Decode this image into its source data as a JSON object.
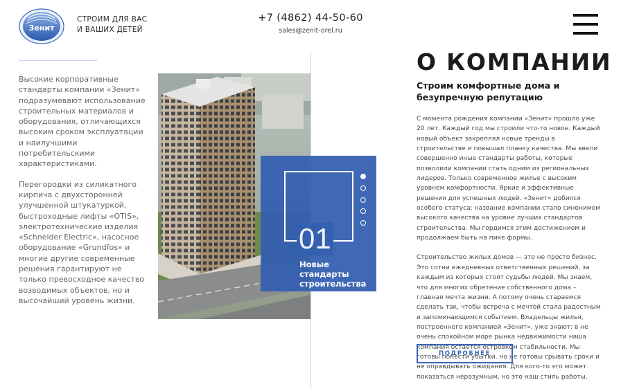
{
  "header": {
    "logo_text": "Зенит",
    "tagline_line1": "СТРОИМ ДЛЯ ВАС",
    "tagline_line2": "И ВАШИХ ДЕТЕЙ",
    "phone": "+7 (4862) 44-50-60",
    "email": "sales@zenit-orel.ru",
    "menu_icon": "hamburger-icon"
  },
  "left_column": {
    "paragraph1": "Высокие корпоративные стандарты компании «Зенит» подразумевают использование строительных материалов и оборудования, отличающихся высоким сроком эксплуатации и наилучшими потребительскими характеристиками.",
    "paragraph2": "Перегородки из силикатного кирпича с двухсторонней улучшенной штукатуркой, быстроходные лифты «OTIS», электротехнические изделия «Schneider Electric», насосное оборудование «Grundfos» и многие другие современные решения гарантируют не только превосходное качество возводимых объектов, но и высочайший уровень жизни."
  },
  "slider": {
    "number": "01",
    "title_line1": "Новые",
    "title_line2": "стандарты",
    "title_line3": "строительства",
    "dot_count": 5,
    "active_dot": 1
  },
  "about": {
    "heading": "О КОМПАНИИ",
    "subtitle": "Строим комфортные дома и безупречную репутацию",
    "paragraph1": "С момента рождения компании «Зенит» прошло уже 20 лет. Каждый год мы строили что-то новое. Каждый новый объект закреплял новые тренды в строительстве и повышал планку качества. Мы ввели совершенно иные стандарты работы, которые позволили компании стать одним из региональных лидеров. Только современное жилье с высоким уровнем комфортности. Яркие и эффективные решения для успешных людей. «Зенит» добился особого статуса: название компании стало синонимом высокого качества на уровне лучших стандартов строительства. Мы гордимся этим достижением и продолжаем быть на пике формы.",
    "paragraph2": "Строительство жилых домов — это не просто бизнес. Это сотни ежедневных ответственных решений, за каждым из которых стоят судьбы людей. Мы знаем, что для многих обретение собственного дома – главная мечта жизни. А потому очень стараемся сделать так, чтобы встреча с мечтой стала радостным и запоминающимся событием. Владельцы жилья, построенного компанией «Зенит», уже знают: в не очень спокойном море рынка недвижимости наша компания остается островком стабильности. Мы готовы понести убытки, но не готовы срывать сроки и не оправдывать ожидания. Для кого-то это может показаться неразумным, но это наш стиль работы.",
    "more_button": "ПОДРОБНЕЕ"
  },
  "colors": {
    "accent": "#3a66b8",
    "overlay": "#3460b0",
    "divider": "#c8d3ea"
  }
}
